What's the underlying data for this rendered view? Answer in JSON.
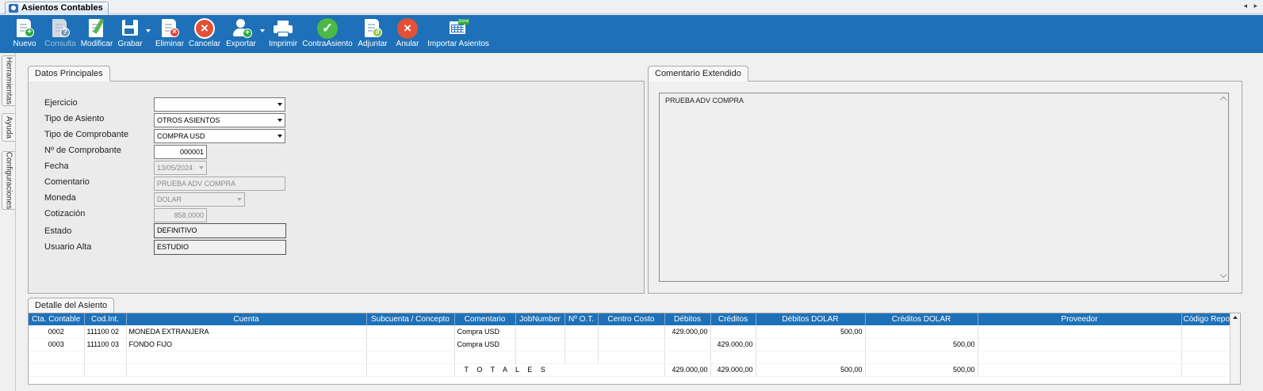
{
  "window": {
    "tab_title": "Asientos Contables"
  },
  "toolbar": {
    "nuevo": "Nuevo",
    "consulta": "Consulta",
    "modificar": "Modificar",
    "grabar": "Grabar",
    "eliminar": "Eliminar",
    "cancelar": "Cancelar",
    "exportar": "Exportar",
    "imprimir": "Imprimir",
    "contra_asiento": "ContraAsiento",
    "adjuntar": "Adjuntar",
    "anular": "Anular",
    "importar_asientos": "Importar Asientos",
    "excel_badge": "Excel"
  },
  "side_tabs": {
    "herramientas": "Herramientas",
    "ayuda": "Ayuda",
    "configuraciones": "Configuraciones"
  },
  "datos_principales": {
    "title": "Datos Principales",
    "ejercicio_label": "Ejercicio",
    "ejercicio_value": "",
    "tipo_asiento_label": "Tipo de Asiento",
    "tipo_asiento_value": "OTROS ASIENTOS",
    "tipo_comprobante_label": "Tipo de Comprobante",
    "tipo_comprobante_value": "COMPRA USD",
    "nro_comprobante_label": "Nº de Comprobante",
    "nro_comprobante_value": "000001",
    "fecha_label": "Fecha",
    "fecha_value": "13/05/2024",
    "comentario_label": "Comentario",
    "comentario_value": "PRUEBA ADV COMPRA",
    "moneda_label": "Moneda",
    "moneda_value": "DOLAR",
    "cotizacion_label": "Cotización",
    "cotizacion_value": "858,0000",
    "estado_label": "Estado",
    "estado_value": "DEFINITIVO",
    "usuario_alta_label": "Usuario Alta",
    "usuario_alta_value": "ESTUDIO"
  },
  "comentario_extendido": {
    "title": "Comentario Extendido",
    "text": "PRUEBA ADV COMPRA"
  },
  "detalle": {
    "title": "Detalle del Asiento",
    "columns": [
      "Cta. Contable",
      "Cod.Int.",
      "Cuenta",
      "Subcuenta / Concepto",
      "Comentario",
      "JobNumber",
      "Nº O.T.",
      "Centro Costo",
      "Débitos",
      "Créditos",
      "Débitos DOLAR",
      "Créditos DOLAR",
      "Proveedor",
      "Código Repo"
    ],
    "rows": [
      [
        "0002",
        "111100 02",
        "MONEDA EXTRANJERA",
        "",
        "Compra USD",
        "",
        "",
        "",
        "429.000,00",
        "",
        "500,00",
        "",
        "",
        ""
      ],
      [
        "0003",
        "111100 03",
        "FONDO FIJO",
        "",
        "Compra USD",
        "",
        "",
        "",
        "",
        "429.000,00",
        "",
        "500,00",
        "",
        ""
      ],
      [
        "",
        "",
        "",
        "",
        "",
        "",
        "",
        "",
        "",
        "",
        "",
        "",
        "",
        ""
      ]
    ],
    "totals": {
      "label": "T O T A L E S",
      "debitos": "429.000,00",
      "creditos": "429.000,00",
      "debitos_dolar": "500,00",
      "creditos_dolar": "500,00"
    }
  }
}
